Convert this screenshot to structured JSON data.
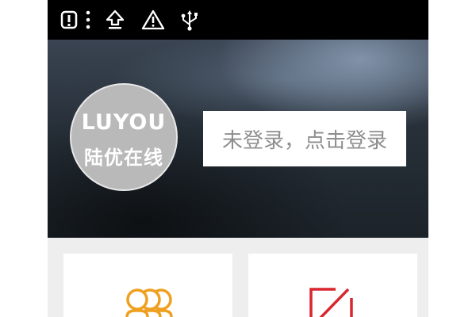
{
  "status_bar": {
    "icons": [
      "alert-box-icon",
      "more-vertical-icon",
      "upload-icon",
      "warning-icon",
      "usb-icon"
    ]
  },
  "header": {
    "logo_word": "LUYOU",
    "logo_cn": "陆优在线",
    "login_prompt": "未登录，点击登录"
  },
  "cards": [
    {
      "icon": "users-icon",
      "color": "#f0a020"
    },
    {
      "icon": "edit-icon",
      "color": "#d9262e"
    }
  ]
}
